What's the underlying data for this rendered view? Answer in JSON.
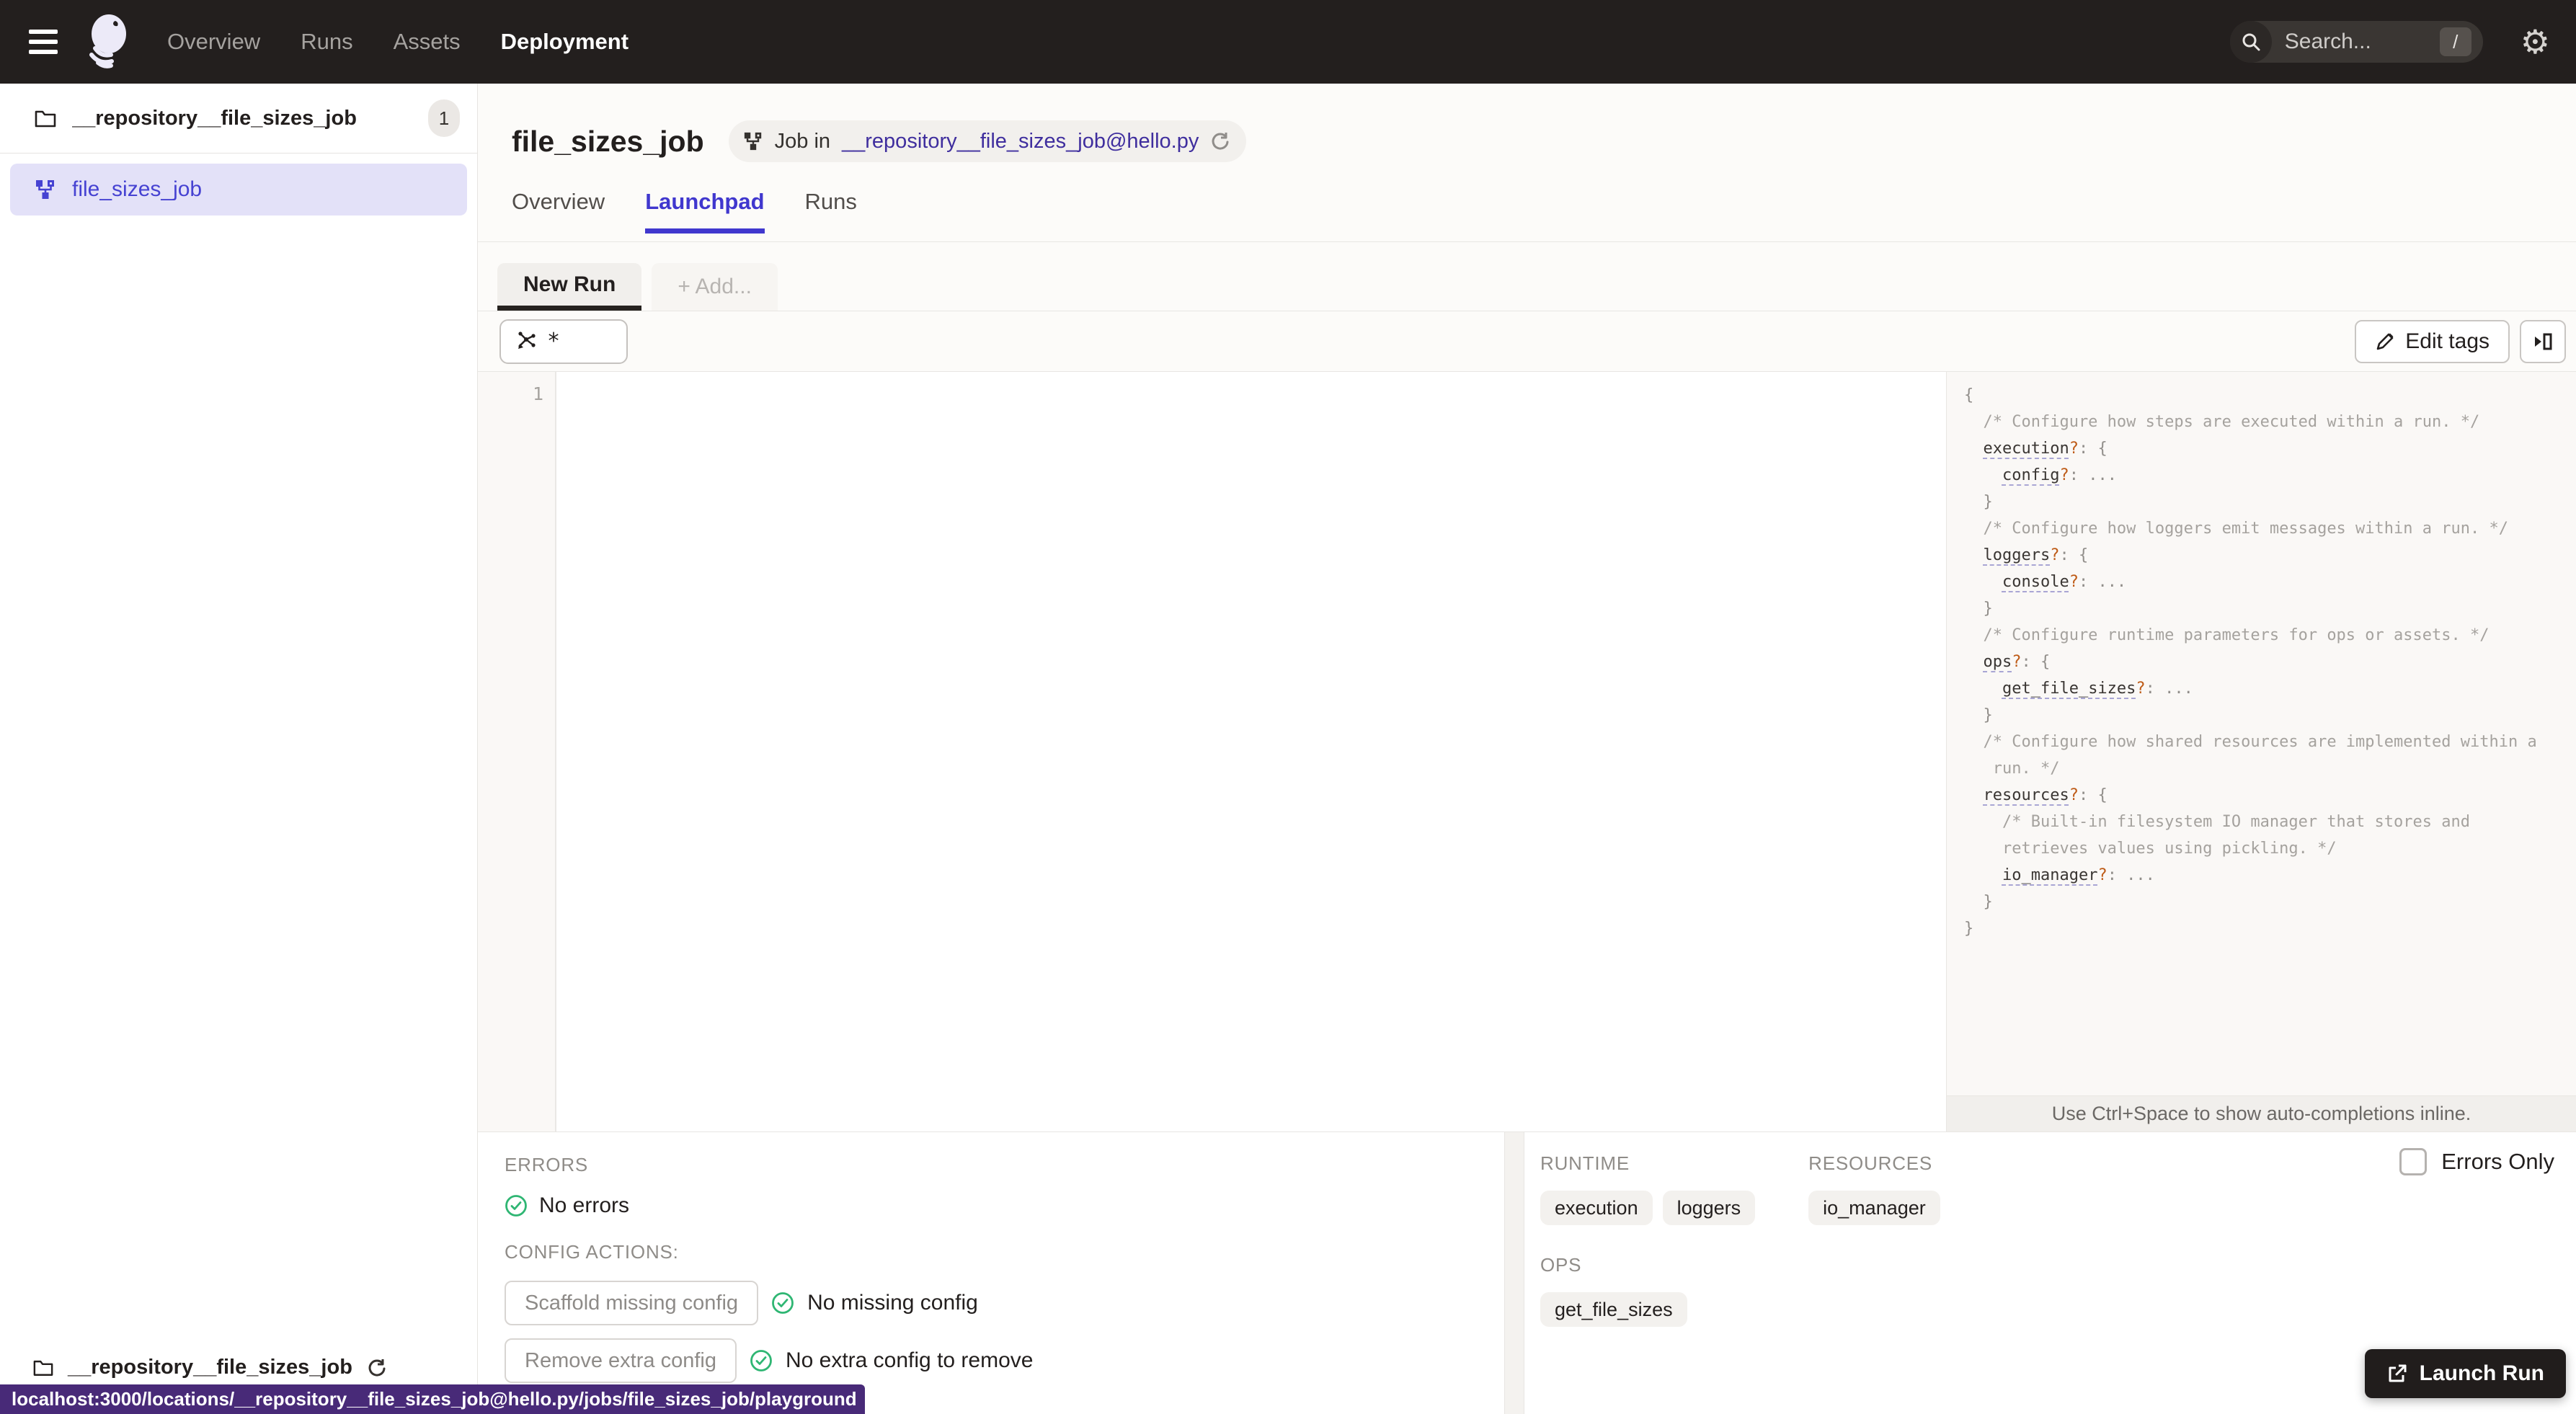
{
  "nav": {
    "links": [
      {
        "label": "Overview",
        "active": false
      },
      {
        "label": "Runs",
        "active": false
      },
      {
        "label": "Assets",
        "active": false
      },
      {
        "label": "Deployment",
        "active": true
      }
    ],
    "search_placeholder": "Search...",
    "search_shortcut": "/"
  },
  "sidebar": {
    "repo_name": "__repository__file_sizes_job",
    "repo_count": "1",
    "selected_job": "file_sizes_job",
    "bottom_repo_name": "__repository__file_sizes_job"
  },
  "header": {
    "title": "file_sizes_job",
    "tag_prefix": "Job in",
    "tag_link": "__repository__file_sizes_job@hello.py"
  },
  "job_tabs": [
    {
      "label": "Overview",
      "active": false
    },
    {
      "label": "Launchpad",
      "active": true
    },
    {
      "label": "Runs",
      "active": false
    }
  ],
  "launchpad": {
    "run_tabs": [
      {
        "label": "New Run",
        "active": true
      },
      {
        "label": "+ Add...",
        "active": false
      }
    ],
    "op_selector_value": "*",
    "edit_tags_label": "Edit tags",
    "editor_line_number": "1",
    "schema_footer": "Use Ctrl+Space to show auto-completions inline.",
    "schema_lines": [
      [
        {
          "s": "p",
          "t": "{"
        }
      ],
      [
        {
          "s": "c",
          "t": "  /* Configure how steps are executed within a run. */"
        }
      ],
      [
        {
          "s": "w",
          "t": "  "
        },
        {
          "s": "k",
          "t": "execution"
        },
        {
          "s": "q",
          "t": "?"
        },
        {
          "s": "p",
          "t": ": {"
        }
      ],
      [
        {
          "s": "w",
          "t": "    "
        },
        {
          "s": "k",
          "t": "config"
        },
        {
          "s": "q",
          "t": "?"
        },
        {
          "s": "p",
          "t": ": ..."
        }
      ],
      [
        {
          "s": "p",
          "t": "  }"
        }
      ],
      [
        {
          "s": "c",
          "t": "  /* Configure how loggers emit messages within a run. */"
        }
      ],
      [
        {
          "s": "w",
          "t": "  "
        },
        {
          "s": "k",
          "t": "loggers"
        },
        {
          "s": "q",
          "t": "?"
        },
        {
          "s": "p",
          "t": ": {"
        }
      ],
      [
        {
          "s": "w",
          "t": "    "
        },
        {
          "s": "k",
          "t": "console"
        },
        {
          "s": "q",
          "t": "?"
        },
        {
          "s": "p",
          "t": ": ..."
        }
      ],
      [
        {
          "s": "p",
          "t": "  }"
        }
      ],
      [
        {
          "s": "c",
          "t": "  /* Configure runtime parameters for ops or assets. */"
        }
      ],
      [
        {
          "s": "w",
          "t": "  "
        },
        {
          "s": "k",
          "t": "ops"
        },
        {
          "s": "q",
          "t": "?"
        },
        {
          "s": "p",
          "t": ": {"
        }
      ],
      [
        {
          "s": "w",
          "t": "    "
        },
        {
          "s": "k",
          "t": "get_file_sizes"
        },
        {
          "s": "q",
          "t": "?"
        },
        {
          "s": "p",
          "t": ": ..."
        }
      ],
      [
        {
          "s": "p",
          "t": "  }"
        }
      ],
      [
        {
          "s": "c",
          "t": "  /* Configure how shared resources are implemented within a"
        }
      ],
      [
        {
          "s": "c",
          "t": "   run. */"
        }
      ],
      [
        {
          "s": "w",
          "t": "  "
        },
        {
          "s": "k",
          "t": "resources"
        },
        {
          "s": "q",
          "t": "?"
        },
        {
          "s": "p",
          "t": ": {"
        }
      ],
      [
        {
          "s": "c",
          "t": "    /* Built-in filesystem IO manager that stores and"
        }
      ],
      [
        {
          "s": "c",
          "t": "    retrieves values using pickling. */"
        }
      ],
      [
        {
          "s": "w",
          "t": "    "
        },
        {
          "s": "k",
          "t": "io_manager"
        },
        {
          "s": "q",
          "t": "?"
        },
        {
          "s": "p",
          "t": ": ..."
        }
      ],
      [
        {
          "s": "p",
          "t": "  }"
        }
      ],
      [
        {
          "s": "p",
          "t": "}"
        }
      ]
    ]
  },
  "bottom": {
    "errors_label": "ERRORS",
    "no_errors_text": "No errors",
    "config_actions_label": "CONFIG ACTIONS:",
    "scaffold_button_label": "Scaffold missing config",
    "no_missing_text": "No missing config",
    "remove_button_label": "Remove extra config",
    "no_extra_text": "No extra config to remove",
    "runtime_label": "RUNTIME",
    "runtime_tags": [
      "execution",
      "loggers"
    ],
    "resources_label": "RESOURCES",
    "resources_tags": [
      "io_manager"
    ],
    "ops_label": "OPS",
    "ops_tags": [
      "get_file_sizes"
    ],
    "errors_only_label": "Errors Only",
    "launch_button_label": "Launch Run"
  },
  "status_tooltip": "localhost:3000/locations/__repository__file_sizes_job@hello.py/jobs/file_sizes_job/playground",
  "colors": {
    "nav_bg": "#231F1E",
    "accent_blurple": "#4642D2",
    "tab_active": "#4037CE",
    "link_purple": "#3F2E9E",
    "success_green": "#2FB673",
    "schema_optional_orange": "#BE5B17",
    "tooltip_purple": "#482A78",
    "selected_item_bg": "#E3E1F8"
  }
}
